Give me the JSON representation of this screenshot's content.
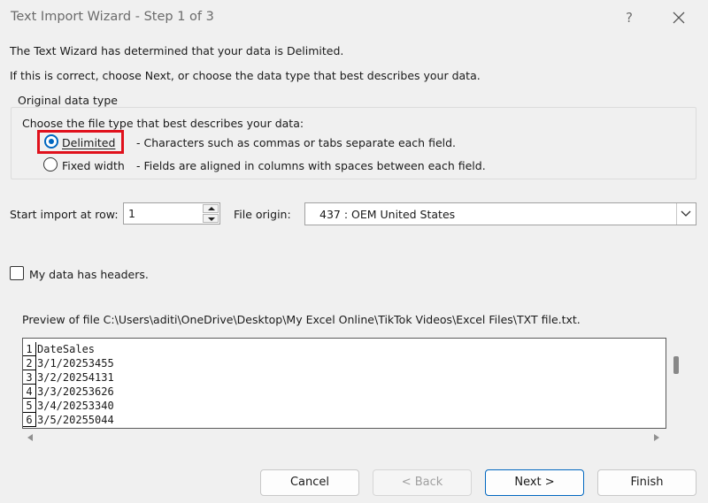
{
  "window": {
    "title": "Text Import Wizard - Step 1 of 3",
    "help_label": "?",
    "close_icon": "close-icon"
  },
  "intro": {
    "line1": "The Text Wizard has determined that your data is Delimited.",
    "line2": "If this is correct, choose Next, or choose the data type that best describes your data."
  },
  "original_data_type": {
    "group_label": "Original data type",
    "prompt": "Choose the file type that best describes your data:",
    "options": [
      {
        "label": "Delimited",
        "description": "- Characters such as commas or tabs separate each field.",
        "selected": true
      },
      {
        "label": "Fixed width",
        "description": "- Fields are aligned in columns with spaces between each field.",
        "selected": false
      }
    ]
  },
  "import_row": {
    "label": "Start import at row:",
    "value": "1"
  },
  "file_origin": {
    "label": "File origin:",
    "value": "437 : OEM United States"
  },
  "headers_checkbox": {
    "label": "My data has headers.",
    "checked": false
  },
  "preview": {
    "label": "Preview of file C:\\Users\\aditi\\OneDrive\\Desktop\\My Excel Online\\TikTok Videos\\Excel Files\\TXT file.txt.",
    "rows": [
      {
        "num": "1",
        "text": "DateSales"
      },
      {
        "num": "2",
        "text": "3/1/20253455"
      },
      {
        "num": "3",
        "text": "3/2/20254131"
      },
      {
        "num": "4",
        "text": "3/3/20253626"
      },
      {
        "num": "5",
        "text": "3/4/20253340"
      },
      {
        "num": "6",
        "text": "3/5/20255044"
      }
    ]
  },
  "buttons": {
    "cancel": "Cancel",
    "back": "< Back",
    "next": "Next >",
    "finish": "Finish"
  },
  "colors": {
    "accent": "#0067c0",
    "highlight": "#e0111c"
  }
}
